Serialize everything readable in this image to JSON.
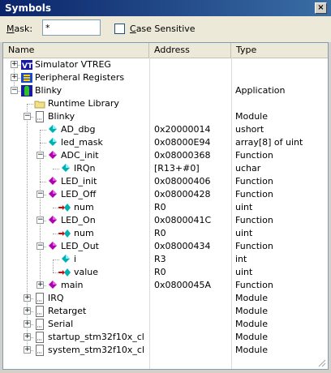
{
  "window": {
    "title": "Symbols",
    "close_glyph": "×"
  },
  "toolbar": {
    "mask_label": "Mask:",
    "mask_value": "*",
    "case_label": "Case Sensitive",
    "case_checked": false
  },
  "columns": {
    "name": "Name",
    "address": "Address",
    "type": "Type"
  },
  "rows": [
    {
      "name": "Simulator VTREG",
      "address": "",
      "type": "",
      "icon": "vtreg-icon",
      "expander": "+"
    },
    {
      "name": "Peripheral Registers",
      "address": "",
      "type": "",
      "icon": "peripheral-registers-icon",
      "expander": "+"
    },
    {
      "name": "Blinky",
      "address": "",
      "type": "Application",
      "icon": "application-icon",
      "expander": "−"
    },
    {
      "name": "Runtime Library",
      "address": "",
      "type": "",
      "icon": "folder-icon",
      "expander": ""
    },
    {
      "name": "Blinky",
      "address": "",
      "type": "Module",
      "icon": "module-icon",
      "expander": "−"
    },
    {
      "name": "AD_dbg",
      "address": "0x20000014",
      "type": "ushort",
      "icon": "variable-icon",
      "expander": ""
    },
    {
      "name": "led_mask",
      "address": "0x08000E94",
      "type": "array[8] of uint",
      "icon": "variable-icon",
      "expander": ""
    },
    {
      "name": "ADC_init",
      "address": "0x08000368",
      "type": "Function",
      "icon": "function-icon",
      "expander": "−"
    },
    {
      "name": "IRQn",
      "address": "[R13+#0]",
      "type": "uchar",
      "icon": "variable-icon",
      "expander": ""
    },
    {
      "name": "LED_init",
      "address": "0x08000406",
      "type": "Function",
      "icon": "function-icon",
      "expander": ""
    },
    {
      "name": "LED_Off",
      "address": "0x08000428",
      "type": "Function",
      "icon": "function-icon",
      "expander": "−"
    },
    {
      "name": "num",
      "address": "R0",
      "type": "uint",
      "icon": "parameter-arrow-icon",
      "expander": ""
    },
    {
      "name": "LED_On",
      "address": "0x0800041C",
      "type": "Function",
      "icon": "function-icon",
      "expander": "−"
    },
    {
      "name": "num",
      "address": "R0",
      "type": "uint",
      "icon": "parameter-arrow-icon",
      "expander": ""
    },
    {
      "name": "LED_Out",
      "address": "0x08000434",
      "type": "Function",
      "icon": "function-icon",
      "expander": "−"
    },
    {
      "name": "i",
      "address": "R3",
      "type": "int",
      "icon": "variable-icon",
      "expander": ""
    },
    {
      "name": "value",
      "address": "R0",
      "type": "uint",
      "icon": "parameter-arrow-icon",
      "expander": ""
    },
    {
      "name": "main",
      "address": "0x0800045A",
      "type": "Function",
      "icon": "function-icon",
      "expander": "+"
    },
    {
      "name": "IRQ",
      "address": "",
      "type": "Module",
      "icon": "module-icon",
      "expander": "+"
    },
    {
      "name": "Retarget",
      "address": "",
      "type": "Module",
      "icon": "module-icon",
      "expander": "+"
    },
    {
      "name": "Serial",
      "address": "",
      "type": "Module",
      "icon": "module-icon",
      "expander": "+"
    },
    {
      "name": "startup_stm32f10x_cl",
      "address": "",
      "type": "Module",
      "icon": "module-icon",
      "expander": "+"
    },
    {
      "name": "system_stm32f10x_cl",
      "address": "",
      "type": "Module",
      "icon": "module-icon",
      "expander": "+"
    }
  ],
  "colors": {
    "titlebar_start": "#0a246a",
    "titlebar_end": "#3a6ea5",
    "function": "#b000b0",
    "variable": "#00b0b0",
    "arrow": "#e00000"
  }
}
